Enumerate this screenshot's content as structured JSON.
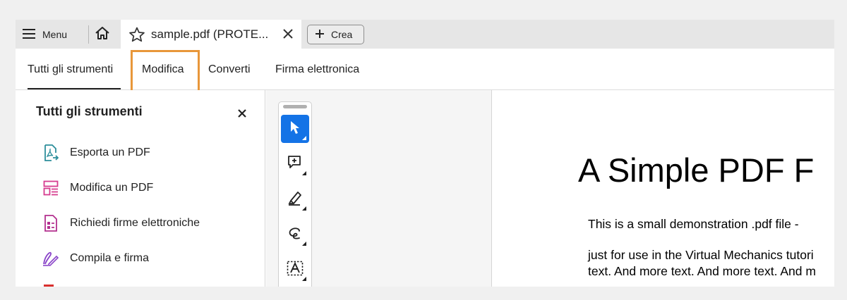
{
  "tabbar": {
    "menu_label": "Menu",
    "doc_tab_title": "sample.pdf (PROTE...",
    "create_label": "Crea"
  },
  "nav": {
    "tabs": [
      {
        "label": "Tutti gli strumenti",
        "selected": true
      },
      {
        "label": "Modifica",
        "selected": false
      },
      {
        "label": "Converti",
        "selected": false
      },
      {
        "label": "Firma elettronica",
        "selected": false
      }
    ],
    "highlighted_tab": "Modifica"
  },
  "panel": {
    "title": "Tutti gli strumenti",
    "items": [
      {
        "label": "Esporta un PDF",
        "icon": "export-pdf-icon",
        "color": "#2d8e9b"
      },
      {
        "label": "Modifica un PDF",
        "icon": "edit-pdf-icon",
        "color": "#d63c8f"
      },
      {
        "label": "Richiedi firme elettroniche",
        "icon": "request-signatures-icon",
        "color": "#b3308f"
      },
      {
        "label": "Compila e firma",
        "icon": "fill-sign-icon",
        "color": "#8a45c9"
      }
    ]
  },
  "toolbar": {
    "tools": [
      "select-cursor-icon",
      "add-comment-icon",
      "highlight-pen-icon",
      "draw-freeform-icon",
      "text-recognition-icon"
    ]
  },
  "document": {
    "heading": "A Simple PDF F",
    "paragraphs": [
      "This is a small demonstration .pdf file -",
      "just for use in the Virtual Mechanics tutori",
      "text. And more text. And more text. And m"
    ]
  },
  "colors": {
    "accent_blue": "#1473e6",
    "highlight_orange": "#e8973a"
  }
}
